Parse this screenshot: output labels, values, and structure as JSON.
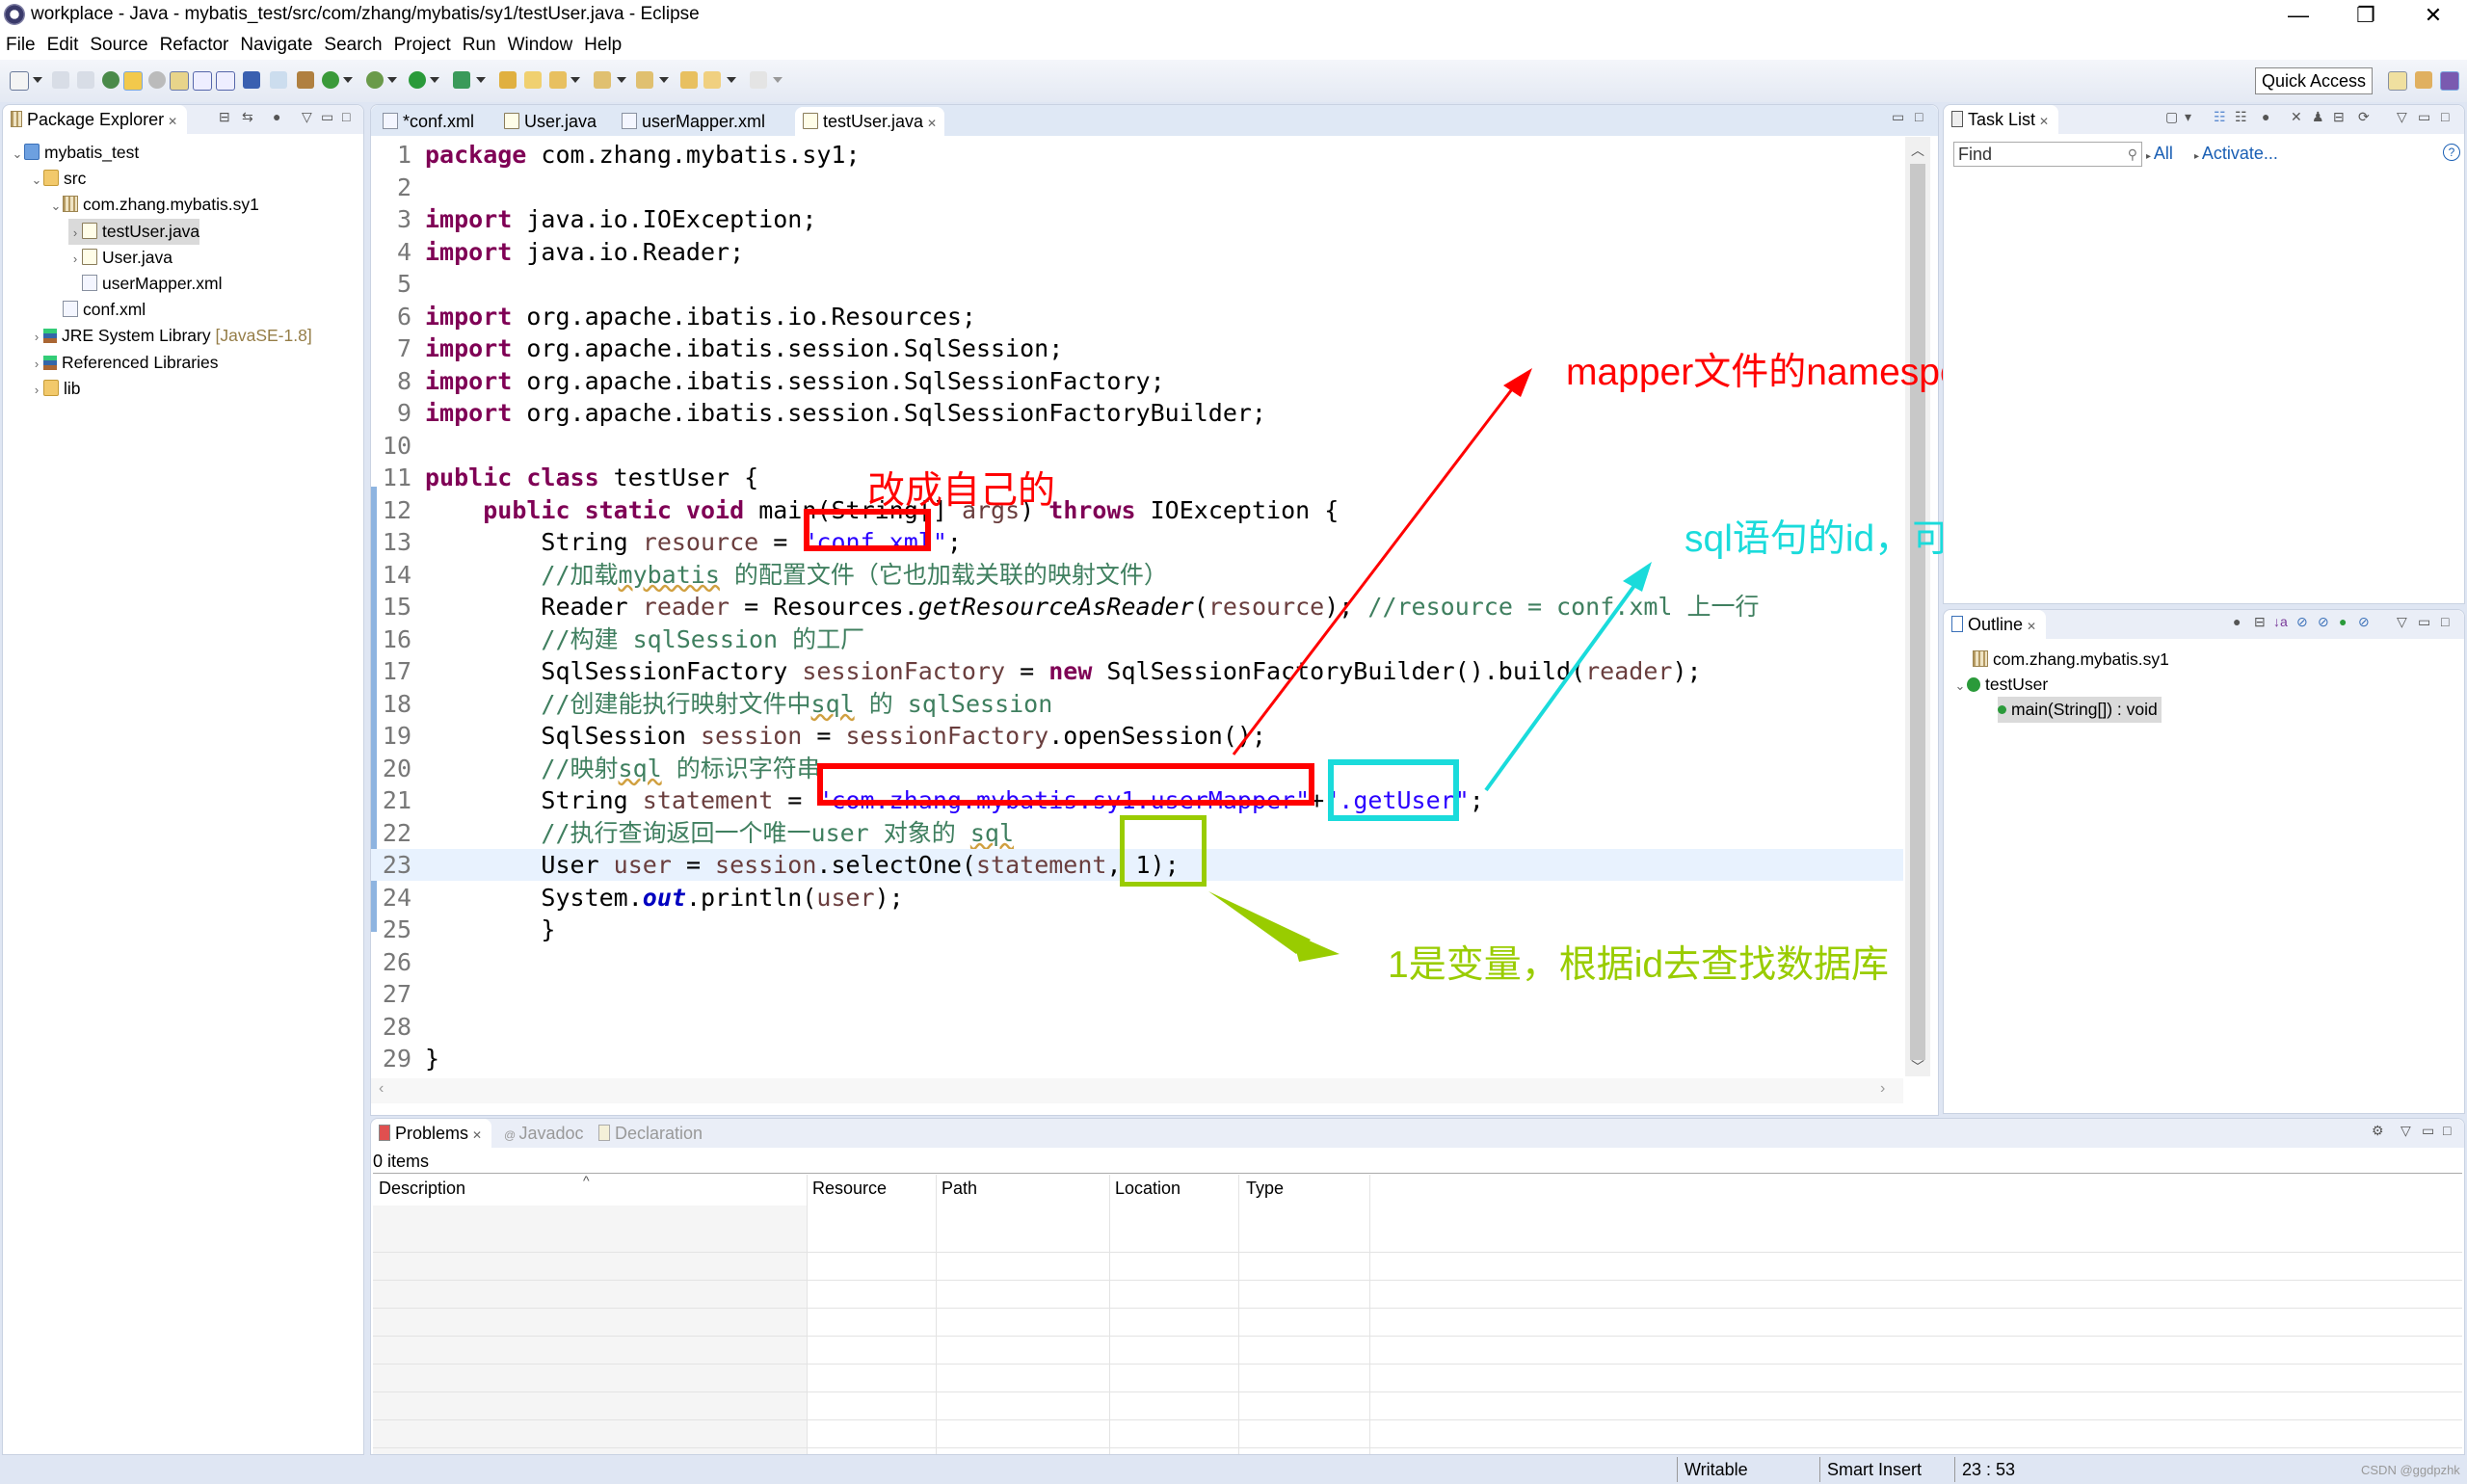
{
  "window": {
    "title": "workplace - Java - mybatis_test/src/com/zhang/mybatis/sy1/testUser.java - Eclipse",
    "minimize_glyph": "—",
    "restore_glyph": "❐",
    "close_glyph": "✕"
  },
  "menu": [
    "File",
    "Edit",
    "Source",
    "Refactor",
    "Navigate",
    "Search",
    "Project",
    "Run",
    "Window",
    "Help"
  ],
  "toolbar": {
    "quick_access": "Quick Access",
    "icons": [
      "new-icon",
      "save-icon",
      "save-all-icon",
      "open-type-icon",
      "toggle-mark-occurrences-icon",
      "toggle-breakpoints-icon",
      "toggle-block-selection-icon",
      "show-whitespace-icon",
      "show-word-wrap-icon",
      "open-console-icon",
      "skip-breakpoints-icon",
      "new-java-package-icon",
      "new-java-class-icon",
      "debug-icon",
      "run-icon",
      "external-tools-icon",
      "open-task-icon",
      "open-resource-icon",
      "search-icon",
      "next-annotation-icon",
      "previous-annotation-icon",
      "last-edit-icon",
      "back-icon",
      "forward-icon"
    ]
  },
  "package_explorer": {
    "title": "Package Explorer",
    "tree": [
      {
        "label": "mybatis_test",
        "icon": "project-icon",
        "twisty": "⌄",
        "level": 0
      },
      {
        "label": "src",
        "icon": "source-folder-icon",
        "twisty": "⌄",
        "level": 1
      },
      {
        "label": "com.zhang.mybatis.sy1",
        "icon": "package-icon",
        "twisty": "⌄",
        "level": 2
      },
      {
        "label": "testUser.java",
        "icon": "java-file-icon",
        "twisty": "›",
        "level": 3,
        "selected": true
      },
      {
        "label": "User.java",
        "icon": "java-file-icon",
        "twisty": "›",
        "level": 3
      },
      {
        "label": "userMapper.xml",
        "icon": "xml-file-icon",
        "twisty": "",
        "level": 3
      },
      {
        "label": "conf.xml",
        "icon": "xml-file-icon",
        "twisty": "",
        "level": 2
      },
      {
        "label": "JRE System Library",
        "suffix": "[JavaSE-1.8]",
        "icon": "library-icon",
        "twisty": "›",
        "level": 1
      },
      {
        "label": "Referenced Libraries",
        "icon": "library-icon",
        "twisty": "›",
        "level": 1
      },
      {
        "label": "lib",
        "icon": "folder-icon",
        "twisty": "›",
        "level": 1
      }
    ]
  },
  "editor": {
    "tabs": [
      {
        "label": "*conf.xml",
        "icon": "xml-file-icon",
        "active": false
      },
      {
        "label": "User.java",
        "icon": "java-file-icon",
        "active": false
      },
      {
        "label": "userMapper.xml",
        "icon": "xml-file-icon",
        "active": false
      },
      {
        "label": "testUser.java",
        "icon": "java-file-icon",
        "active": true
      }
    ],
    "current_line": 23,
    "lines": [
      [
        {
          "t": "package",
          "c": "kw"
        },
        {
          "t": " com.zhang.mybatis.sy1;"
        }
      ],
      [],
      [
        {
          "t": "import",
          "c": "kw"
        },
        {
          "t": " java.io.IOException;"
        }
      ],
      [
        {
          "t": "import",
          "c": "kw"
        },
        {
          "t": " java.io.Reader;"
        }
      ],
      [],
      [
        {
          "t": "import",
          "c": "kw"
        },
        {
          "t": " org.apache.ibatis.io.Resources;"
        }
      ],
      [
        {
          "t": "import",
          "c": "kw"
        },
        {
          "t": " org.apache.ibatis.session.SqlSession;"
        }
      ],
      [
        {
          "t": "import",
          "c": "kw"
        },
        {
          "t": " org.apache.ibatis.session.SqlSessionFactory;"
        }
      ],
      [
        {
          "t": "import",
          "c": "kw"
        },
        {
          "t": " org.apache.ibatis.session.SqlSessionFactoryBuilder;"
        }
      ],
      [],
      [
        {
          "t": "public class",
          "c": "kw"
        },
        {
          "t": " testUser {"
        }
      ],
      [
        {
          "t": "    "
        },
        {
          "t": "public static void",
          "c": "kw"
        },
        {
          "t": " main(String[] "
        },
        {
          "t": "args",
          "c": "var"
        },
        {
          "t": ") "
        },
        {
          "t": "throws",
          "c": "kw"
        },
        {
          "t": " IOException {"
        }
      ],
      [
        {
          "t": "        String "
        },
        {
          "t": "resource",
          "c": "var"
        },
        {
          "t": " = "
        },
        {
          "t": "\"conf.xml\"",
          "c": "str"
        },
        {
          "t": ";"
        }
      ],
      [
        {
          "t": "        //加载",
          "c": "cm"
        },
        {
          "t": "mybatis",
          "c": "cm squig"
        },
        {
          "t": " 的配置文件（它也加载关联的映射文件）",
          "c": "cm"
        }
      ],
      [
        {
          "t": "        Reader "
        },
        {
          "t": "reader",
          "c": "var"
        },
        {
          "t": " = Resources."
        },
        {
          "t": "getResourceAsReader",
          "c": "it"
        },
        {
          "t": "("
        },
        {
          "t": "resource",
          "c": "var"
        },
        {
          "t": "); "
        },
        {
          "t": "//resource = conf.xml 上一行",
          "c": "cm"
        }
      ],
      [
        {
          "t": "        //构建 sqlSession 的工厂",
          "c": "cm"
        }
      ],
      [
        {
          "t": "        SqlSessionFactory "
        },
        {
          "t": "sessionFactory",
          "c": "var"
        },
        {
          "t": " = "
        },
        {
          "t": "new",
          "c": "kw"
        },
        {
          "t": " SqlSessionFactoryBuilder().build("
        },
        {
          "t": "reader",
          "c": "var"
        },
        {
          "t": ");"
        }
      ],
      [
        {
          "t": "        //创建能执行映射文件中",
          "c": "cm"
        },
        {
          "t": "sql",
          "c": "cm squig"
        },
        {
          "t": " 的 sqlSession",
          "c": "cm"
        }
      ],
      [
        {
          "t": "        SqlSession "
        },
        {
          "t": "session",
          "c": "var"
        },
        {
          "t": " = "
        },
        {
          "t": "sessionFactory",
          "c": "var"
        },
        {
          "t": ".openSession();"
        }
      ],
      [
        {
          "t": "        //映射",
          "c": "cm"
        },
        {
          "t": "sql",
          "c": "cm squig"
        },
        {
          "t": " 的标识字符串",
          "c": "cm"
        }
      ],
      [
        {
          "t": "        String "
        },
        {
          "t": "statement",
          "c": "var"
        },
        {
          "t": " = "
        },
        {
          "t": "\"com.zhang.mybatis.sy1.userMapper\"",
          "c": "str"
        },
        {
          "t": "+"
        },
        {
          "t": "\".getUser\"",
          "c": "str"
        },
        {
          "t": ";"
        }
      ],
      [
        {
          "t": "        //执行查询返回一个唯一",
          "c": "cm"
        },
        {
          "t": "user",
          "c": "cm"
        },
        {
          "t": " 对象的 ",
          "c": "cm"
        },
        {
          "t": "sql",
          "c": "cm squig"
        }
      ],
      [
        {
          "t": "        User "
        },
        {
          "t": "user",
          "c": "var"
        },
        {
          "t": " = "
        },
        {
          "t": "session",
          "c": "var"
        },
        {
          "t": ".selectOne("
        },
        {
          "t": "statement",
          "c": "var"
        },
        {
          "t": ", 1);"
        }
      ],
      [
        {
          "t": "        System."
        },
        {
          "t": "out",
          "c": "fld"
        },
        {
          "t": ".println("
        },
        {
          "t": "user",
          "c": "var"
        },
        {
          "t": ");"
        }
      ],
      [
        {
          "t": "        }"
        }
      ],
      [],
      [],
      [],
      [
        {
          "t": "}"
        }
      ],
      []
    ]
  },
  "annotations": {
    "red_box_label": "改成自己的",
    "namespace_label": "mapper文件的namespcae",
    "id_label": "sql语句的id，可能有多个增删改查的语句",
    "param_label": "1是变量，根据id去查找数据库",
    "colors": {
      "red": "#ff0000",
      "cyan": "#1adbdb",
      "green": "#99cc00"
    }
  },
  "task_list": {
    "title": "Task List",
    "find_placeholder": "Find",
    "all_link": "All",
    "activate_link": "Activate...",
    "help_glyph": "?"
  },
  "outline": {
    "title": "Outline",
    "items": [
      {
        "label": "com.zhang.mybatis.sy1",
        "icon": "package-icon"
      },
      {
        "label": "testUser",
        "icon": "class-icon",
        "twisty": "⌄"
      },
      {
        "label": "main(String[]) : void",
        "icon": "public-static-method-icon",
        "selected": true
      }
    ]
  },
  "problems": {
    "tabs": [
      {
        "label": "Problems",
        "active": true
      },
      {
        "label": "Javadoc",
        "active": false
      },
      {
        "label": "Declaration",
        "active": false
      }
    ],
    "count": "0 items",
    "columns": [
      "Description",
      "Resource",
      "Path",
      "Location",
      "Type"
    ],
    "sort_glyph": "^"
  },
  "statusbar": {
    "mode": "Writable",
    "insert_mode": "Smart Insert",
    "position": "23 : 53",
    "watermark": "CSDN @ggdpzhk"
  }
}
